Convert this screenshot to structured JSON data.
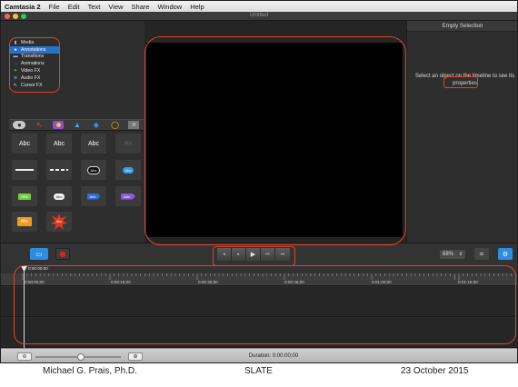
{
  "menubar": {
    "app": "Camtasia 2",
    "items": [
      "File",
      "Edit",
      "Text",
      "View",
      "Share",
      "Window",
      "Help"
    ]
  },
  "window": {
    "title": "Untitled"
  },
  "tabs": [
    {
      "label": "Media",
      "icon": "film-icon"
    },
    {
      "label": "Annotations",
      "icon": "speech-bubble-icon",
      "active": true
    },
    {
      "label": "Transitions",
      "icon": "transition-icon"
    },
    {
      "label": "Animations",
      "icon": "arrow-icon"
    },
    {
      "label": "Video FX",
      "icon": "fx-icon"
    },
    {
      "label": "Audio FX",
      "icon": "waveform-icon"
    },
    {
      "label": "Cursor FX",
      "icon": "cursor-icon"
    }
  ],
  "annotation_tiles": {
    "abc": "Abc",
    "bubble_text": "Abc"
  },
  "properties_panel": {
    "header": "Empty Selection",
    "message_line1": "Select an object on the timeline to see its",
    "message_line2": "properties"
  },
  "zoom": {
    "level": "68%"
  },
  "timeline": {
    "playhead_time": "0:00:00;00",
    "ticks": [
      "0:00:00;00",
      "0:00:15;00",
      "0:00:30;00",
      "0:00:45;00",
      "0:01:00;00",
      "0:01:15;00"
    ]
  },
  "status": {
    "duration": "Duration: 0:00:00;00"
  },
  "footer": {
    "author": "Michael G. Prais, Ph.D.",
    "org": "SLATE",
    "date": "23 October 2015"
  },
  "colors": {
    "accent_blue": "#2a72c8",
    "callout_red": "#e2422a",
    "record_red": "#e0241c"
  }
}
